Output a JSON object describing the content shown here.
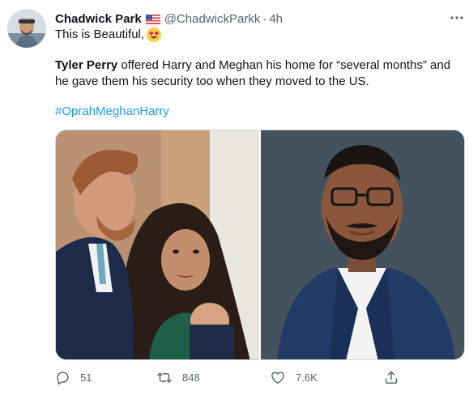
{
  "tweet": {
    "author_name": "Chadwick Park",
    "author_handle": "@ChadwickParkk",
    "separator": "·",
    "time": "4h",
    "first_line": "This is Beautiful,",
    "bold_name": "Tyler Perry",
    "body_rest": " offered Harry and Meghan his home for “several months” and he gave them his security too when they moved to the US.",
    "hashtag": "#OprahMeghanHarry"
  },
  "actions": {
    "replies": "51",
    "retweets": "848",
    "likes": "7.6K"
  },
  "icons": {
    "flag": "us-flag-icon",
    "emoji": "heart-eyes-emoji-icon",
    "more": "more-dots-icon",
    "reply": "reply-icon",
    "retweet": "retweet-icon",
    "like": "heart-icon",
    "share": "share-icon"
  },
  "colors": {
    "accent": "#1d9bf0",
    "text": "#0f1419",
    "secondary": "#536471"
  }
}
